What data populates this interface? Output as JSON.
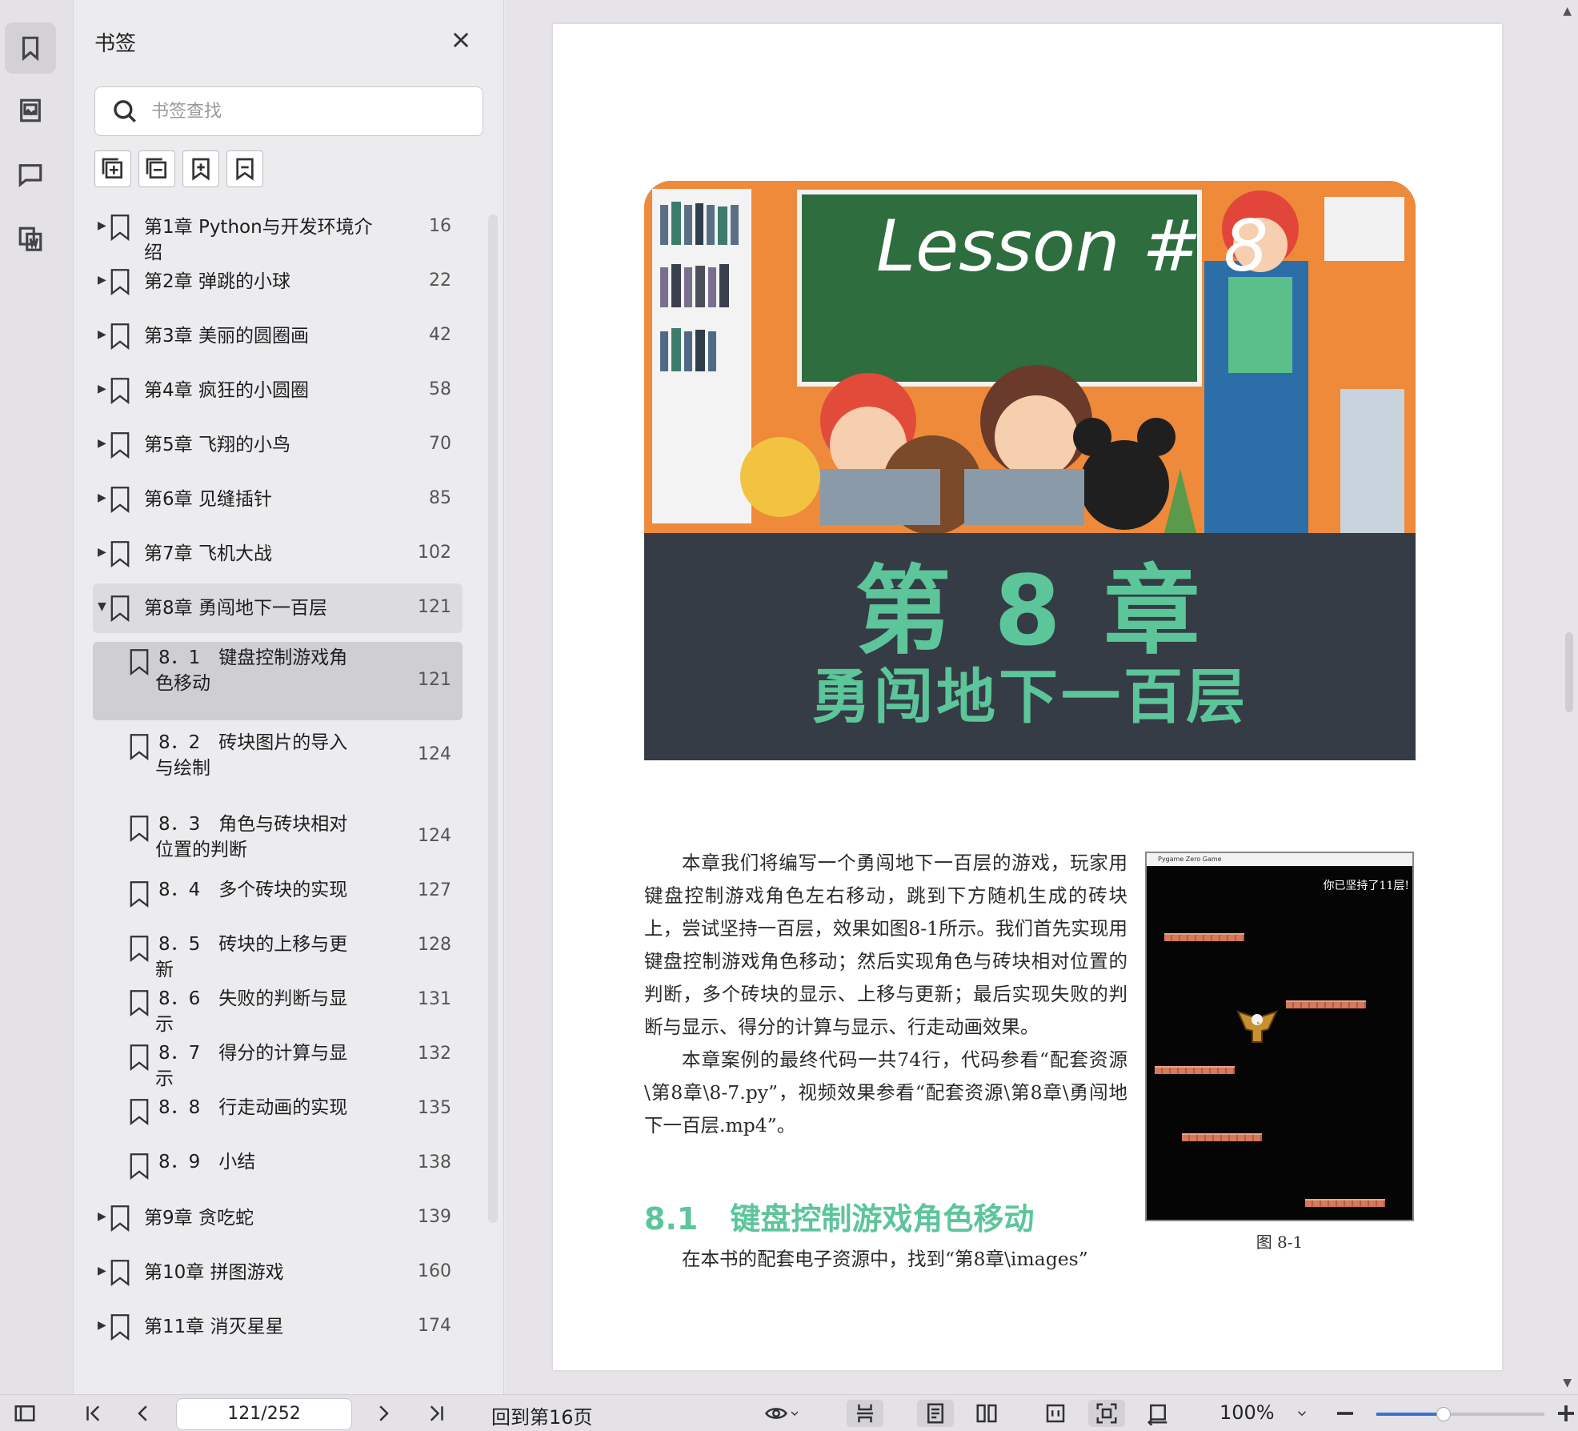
{
  "panel": {
    "title": "书签",
    "search_placeholder": "书签查找"
  },
  "bookmarks": [
    {
      "label": "第1章 Python与开发环境介绍",
      "page": "16",
      "level": 0,
      "expanded": false
    },
    {
      "label": "第2章 弹跳的小球",
      "page": "22",
      "level": 0,
      "expanded": false
    },
    {
      "label": "第3章 美丽的圆圈画",
      "page": "42",
      "level": 0,
      "expanded": false
    },
    {
      "label": "第4章 疯狂的小圆圈",
      "page": "58",
      "level": 0,
      "expanded": false
    },
    {
      "label": "第5章 飞翔的小鸟",
      "page": "70",
      "level": 0,
      "expanded": false
    },
    {
      "label": "第6章 见缝插针",
      "page": "85",
      "level": 0,
      "expanded": false
    },
    {
      "label": "第7章 飞机大战",
      "page": "102",
      "level": 0,
      "expanded": false
    },
    {
      "label": "第8章 勇闯地下一百层",
      "page": "121",
      "level": 0,
      "expanded": true
    },
    {
      "label": "8．1　键盘控制游戏角色移动",
      "page": "121",
      "level": 1,
      "selected": true
    },
    {
      "label": "8．2　砖块图片的导入与绘制",
      "page": "124",
      "level": 1
    },
    {
      "label": "8．3　角色与砖块相对位置的判断",
      "page": "124",
      "level": 1
    },
    {
      "label": "8．4　多个砖块的实现",
      "page": "127",
      "level": 1
    },
    {
      "label": "8．5　砖块的上移与更新",
      "page": "128",
      "level": 1
    },
    {
      "label": "8．6　失败的判断与显示",
      "page": "131",
      "level": 1
    },
    {
      "label": "8．7　得分的计算与显示",
      "page": "132",
      "level": 1
    },
    {
      "label": "8．8　行走动画的实现",
      "page": "135",
      "level": 1
    },
    {
      "label": "8．9　小结",
      "page": "138",
      "level": 1
    },
    {
      "label": "第9章 贪吃蛇",
      "page": "139",
      "level": 0,
      "expanded": false
    },
    {
      "label": "第10章 拼图游戏",
      "page": "160",
      "level": 0,
      "expanded": false
    },
    {
      "label": "第11章 消灭星星",
      "page": "174",
      "level": 0,
      "expanded": false
    }
  ],
  "document": {
    "banner_lesson": "Lesson # 8",
    "chapter_title": "第 8 章",
    "chapter_subtitle": "勇闯地下一百层",
    "paragraph1": "本章我们将编写一个勇闯地下一百层的游戏，玩家用键盘控制游戏角色左右移动，跳到下方随机生成的砖块上，尝试坚持一百层，效果如图8-1所示。我们首先实现用键盘控制游戏角色移动；然后实现角色与砖块相对位置的判断，多个砖块的显示、上移与更新；最后实现失败的判断与显示、得分的计算与显示、行走动画效果。",
    "paragraph2": "本章案例的最终代码一共74行，代码参看“配套资源\\第8章\\8-7.py”，视频效果参看“配套资源\\第8章\\勇闯地下一百层.mp4”。",
    "section_number": "8.1",
    "section_title": "键盘控制游戏角色移动",
    "last_line": "在本书的配套电子资源中，找到“第8章\\images”",
    "figure_window_title": "Pygame Zero Game",
    "figure_score": "你已坚持了11层!",
    "figure_caption": "图 8-1"
  },
  "bottombar": {
    "page_field": "121/252",
    "back_to": "回到第16页",
    "zoom": "100%",
    "zoom_level": 0.4
  }
}
